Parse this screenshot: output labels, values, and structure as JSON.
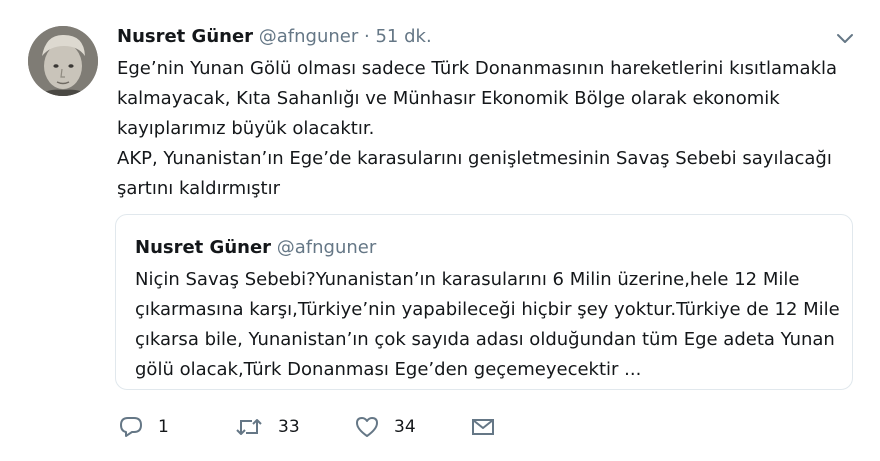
{
  "tweet": {
    "author_name": "Nusret Güner",
    "author_handle": "@afnguner",
    "separator": "·",
    "time": "51 dk.",
    "body_lines": [
      "Ege’nin Yunan Gölü olması sadece Türk Donanmasının hareketlerini kısıtlamakla",
      "kalmayacak, Kıta Sahanlığı ve Münhasır Ekonomik Bölge olarak ekonomik",
      "kayıplarımız büyük olacaktır.",
      "AKP, Yunanistan’ın Ege’de karasularını genişletmesinin Savaş Sebebi sayılacağı",
      "şartını kaldırmıştır"
    ]
  },
  "quoted_tweet": {
    "author_name": "Nusret Güner",
    "author_handle": "@afnguner",
    "body_lines": [
      "Niçin Savaş Sebebi?Yunanistan’ın karasularını 6 Milin üzerine,hele 12 Mile",
      "çıkarmasına karşı,Türkiye’nin yapabileceği hiçbir şey yoktur.Türkiye de 12 Mile",
      "çıkarsa bile, Yunanistan’ın çok sayıda adası olduğundan tüm Ege adeta Yunan",
      "gölü olacak,Türk Donanması Ege’den geçemeyecektir ..."
    ]
  },
  "actions": {
    "reply": {
      "icon": "reply-icon",
      "count": "1"
    },
    "retweet": {
      "icon": "retweet-icon",
      "count": "33"
    },
    "like": {
      "icon": "heart-icon",
      "count": "34"
    },
    "message": {
      "icon": "envelope-icon"
    }
  },
  "colors": {
    "text": "#14171a",
    "muted": "#657786",
    "border": "#e1e8ed"
  }
}
